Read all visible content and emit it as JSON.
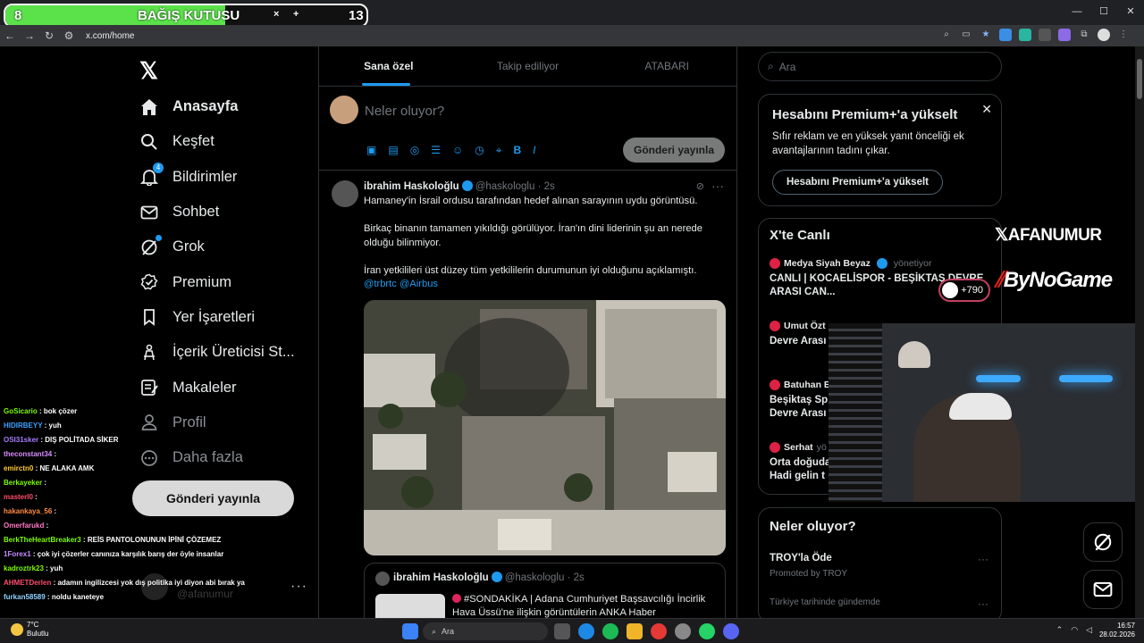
{
  "browser": {
    "url": "x.com/home",
    "window_controls": [
      "—",
      "☐",
      "✕"
    ]
  },
  "donation": {
    "left_count": "8",
    "title": "BAĞIŞ KUTUSU",
    "close": "×",
    "plus": "+",
    "right_count": "13",
    "progress_fraction": 0.61
  },
  "nav": {
    "logo": "𝕏",
    "items": [
      {
        "label": "Anasayfa",
        "icon": "home-icon"
      },
      {
        "label": "Keşfet",
        "icon": "search-icon"
      },
      {
        "label": "Bildirimler",
        "icon": "bell-icon",
        "badge": "4"
      },
      {
        "label": "Sohbet",
        "icon": "mail-icon"
      },
      {
        "label": "Grok",
        "icon": "grok-icon"
      },
      {
        "label": "Premium",
        "icon": "premium-icon"
      },
      {
        "label": "Yer İşaretleri",
        "icon": "bookmark-icon"
      },
      {
        "label": "İçerik Üreticisi St...",
        "icon": "creator-icon"
      },
      {
        "label": "Makaleler",
        "icon": "article-icon"
      },
      {
        "label": "Profil",
        "icon": "profile-icon"
      },
      {
        "label": "Daha fazla",
        "icon": "more-icon"
      }
    ],
    "post_button": "Gönderi yayınla",
    "profile_handle": "@afanumur",
    "profile_more": "···"
  },
  "chat": [
    {
      "user": "GoSicario",
      "color": "#7cfc00",
      "msg": "bok çözer"
    },
    {
      "user": "HIDIRBEYY",
      "color": "#3fa0ff",
      "msg": "yuh"
    },
    {
      "user": "OSI31sker",
      "color": "#a77bff",
      "msg": "DIŞ POLİTADA SİKER"
    },
    {
      "user": "theconstant34",
      "color": "#d98cff",
      "msg": ""
    },
    {
      "user": "emirctn0",
      "color": "#ffcc33",
      "msg": "NE ALAKA AMK"
    },
    {
      "user": "Berkayeker",
      "color": "#7cfc00",
      "msg": ""
    },
    {
      "user": "masterl0",
      "color": "#ff4d6d",
      "msg": ""
    },
    {
      "user": "hakankaya_56",
      "color": "#ff8c42",
      "msg": ""
    },
    {
      "user": "Omerfarukd",
      "color": "#ff7ac6",
      "msg": ""
    },
    {
      "user": "BerkTheHeartBreaker3",
      "color": "#7cfc00",
      "msg": "REİS PANTOLONUNUN İPİNİ ÇÖZEMEZ"
    },
    {
      "user": "1Forex1",
      "color": "#c58cff",
      "msg": "çok iyi çözerler canınıza karşılık barış der öyle insanlar"
    },
    {
      "user": "kadroztrk23",
      "color": "#7cfc00",
      "msg": "yuh"
    },
    {
      "user": "AHMETDerlen",
      "color": "#ff4d6d",
      "msg": "adamın ingilizcesi yok dış politika iyi diyon abi bırak ya"
    },
    {
      "user": "furkan58589",
      "color": "#8fd3ff",
      "msg": "noldu kaneteye"
    }
  ],
  "center": {
    "tabs": [
      "Sana özel",
      "Takip ediliyor",
      "ATABARI"
    ],
    "compose_placeholder": "Neler oluyor?",
    "compose_post": "Gönderi yayınla",
    "compose_tools": [
      "▣",
      "▤",
      "◎",
      "☰",
      "☺",
      "◷",
      "⌖",
      "B",
      "I"
    ]
  },
  "tweet": {
    "name": "ibrahim Haskoloğlu",
    "handle": "@haskologlu · 2s",
    "more": "···",
    "text1": "Hamaney'in İsrail ordusu tarafından hedef alınan sarayının uydu görüntüsü.",
    "text2": "Birkaç binanın tamamen yıkıldığı görülüyor. İran'ın dini liderinin şu an nerede olduğu bilinmiyor.",
    "text3": "İran yetkilileri üst düzey tüm yetkililerin durumunun iyi olduğunu açıklamıştı.",
    "mentions": "@trbrtc @Airbus",
    "quote_name": "ibrahim Haskoloğlu",
    "quote_handle": "@haskologlu · 2s",
    "quote_text": "#SONDAKİKA | Adana Cumhuriyet Başsavcılığı İncirlik Hava Üssü'ne ilişkin görüntülerin ANKA Haber"
  },
  "right": {
    "search_placeholder": "Ara",
    "premium_title": "Hesabını Premium+'a yükselt",
    "premium_close": "✕",
    "premium_text": "Sıfır reklam ve en yüksek yanıt önceliği ek avantajlarının tadını çıkar.",
    "premium_button": "Hesabını Premium+'a yükselt",
    "live_title": "X'te Canlı",
    "live_items": [
      {
        "who": "Medya Siyah Beyaz",
        "sub": "yönetiyor",
        "title": "CANLI | KOCAELİSPOR - BEŞİKTAŞ DEVRE ARASI CAN..."
      },
      {
        "who": "Umut Özt",
        "sub": "",
        "title": "Devre Arası"
      },
      {
        "who": "Batuhan E",
        "sub": "",
        "title": "Beşiktaş Sp Devre Arası"
      },
      {
        "who": "Serhat",
        "sub": "yö",
        "title": "Orta doğuda Hadi gelin t"
      }
    ],
    "live_count": "+790",
    "trends_title": "Neler oluyor?",
    "trend1": "TROY'la Öde",
    "trend1_promo": "Promoted by TROY",
    "trend2_context": "Türkiye tarihinde gündemde",
    "trend_more": "···"
  },
  "overlay": {
    "brand1": "𝕏AFANUMUR",
    "brand2_mark": "⫽",
    "brand2": "ByNoGame"
  },
  "taskbar": {
    "temp": "7°C",
    "weather": "Bulutlu",
    "search": "Ara",
    "time": "16:57",
    "date": "28.02.2026"
  }
}
